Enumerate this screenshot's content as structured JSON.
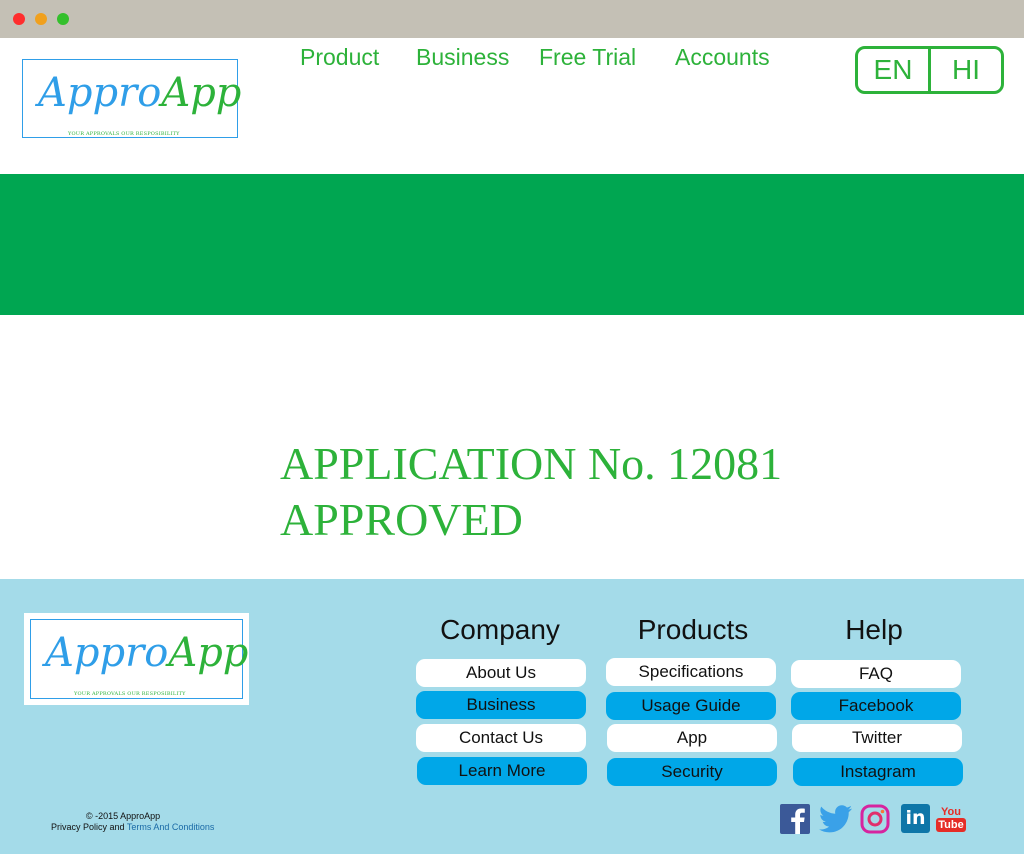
{
  "window": {
    "controls": [
      "close",
      "minimize",
      "maximize"
    ]
  },
  "brand": {
    "logo_part1": "Appro",
    "logo_part2": "App",
    "tagline": "YOUR APPROVALS OUR RESPOSIBILITY"
  },
  "nav": {
    "items": [
      {
        "label": "Product"
      },
      {
        "label": "Business"
      },
      {
        "label": "Free Trial"
      },
      {
        "label": "Accounts"
      }
    ]
  },
  "language": {
    "options": [
      "EN",
      "HI"
    ]
  },
  "main": {
    "message_line1": "APPLICATION No. 12081",
    "message_line2": "APPROVED"
  },
  "footer": {
    "columns": [
      {
        "title": "Company",
        "links": [
          "About Us",
          "Business",
          "Contact Us",
          "Learn More"
        ]
      },
      {
        "title": "Products",
        "links": [
          "Specifications",
          "Usage Guide",
          "App",
          "Security"
        ]
      },
      {
        "title": "Help",
        "links": [
          "FAQ",
          "Facebook",
          "Twitter",
          "Instagram"
        ]
      }
    ],
    "copyright": "© -2015  ApproApp",
    "policy_prefix": "Privacy Policy and ",
    "policy_link": "Terms And Conditions",
    "social": [
      "facebook-icon",
      "twitter-icon",
      "instagram-icon",
      "linkedin-icon",
      "youtube-icon"
    ],
    "social_text": {
      "linkedin": "in",
      "youtube_top": "You",
      "youtube_bottom": "Tube"
    }
  },
  "colors": {
    "brand_green": "#2db23a",
    "banner_green": "#00a651",
    "brand_blue": "#2f9ee8",
    "footer_bg": "#a4dbe9",
    "button_blue": "#00a7e8"
  }
}
